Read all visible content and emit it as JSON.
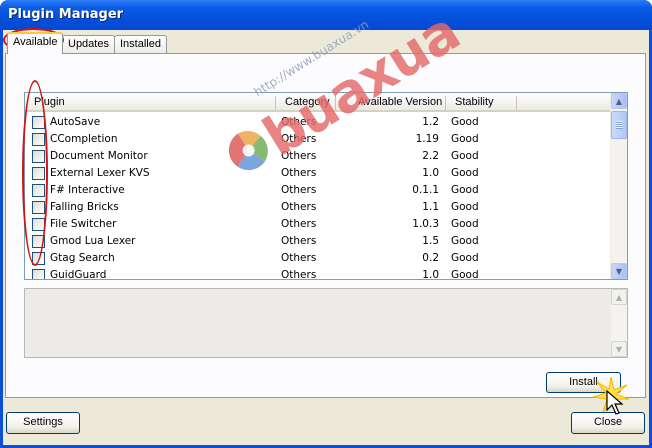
{
  "window": {
    "title": "Plugin Manager"
  },
  "tabs": [
    {
      "label": "Available",
      "active": true
    },
    {
      "label": "Updates",
      "active": false
    },
    {
      "label": "Installed",
      "active": false
    }
  ],
  "columns": [
    "Plugin",
    "Category",
    "Available Version",
    "Stability"
  ],
  "plugins": [
    {
      "name": "AutoSave",
      "category": "Others",
      "version": "1.2",
      "stability": "Good",
      "checked": false
    },
    {
      "name": "CCompletion",
      "category": "Others",
      "version": "1.19",
      "stability": "Good",
      "checked": false
    },
    {
      "name": "Document Monitor",
      "category": "Others",
      "version": "2.2",
      "stability": "Good",
      "checked": false
    },
    {
      "name": "External Lexer KVS",
      "category": "Others",
      "version": "1.0",
      "stability": "Good",
      "checked": false
    },
    {
      "name": "F# Interactive",
      "category": "Others",
      "version": "0.1.1",
      "stability": "Good",
      "checked": false
    },
    {
      "name": "Falling Bricks",
      "category": "Others",
      "version": "1.1",
      "stability": "Good",
      "checked": false
    },
    {
      "name": "File Switcher",
      "category": "Others",
      "version": "1.0.3",
      "stability": "Good",
      "checked": false
    },
    {
      "name": "Gmod Lua Lexer",
      "category": "Others",
      "version": "1.5",
      "stability": "Good",
      "checked": false
    },
    {
      "name": "Gtag Search",
      "category": "Others",
      "version": "0.2",
      "stability": "Good",
      "checked": false
    },
    {
      "name": "GuidGuard",
      "category": "Others",
      "version": "1.0",
      "stability": "Good",
      "checked": false
    }
  ],
  "buttons": {
    "install": "Install",
    "settings": "Settings",
    "close": "Close"
  },
  "watermark": {
    "url": "http://www.buaxua.vn",
    "text": "buaxua"
  },
  "colors": {
    "title_bar": "#0550dc",
    "highlight_ring": "#cc1616",
    "tab_accent": "#ffc83c"
  }
}
